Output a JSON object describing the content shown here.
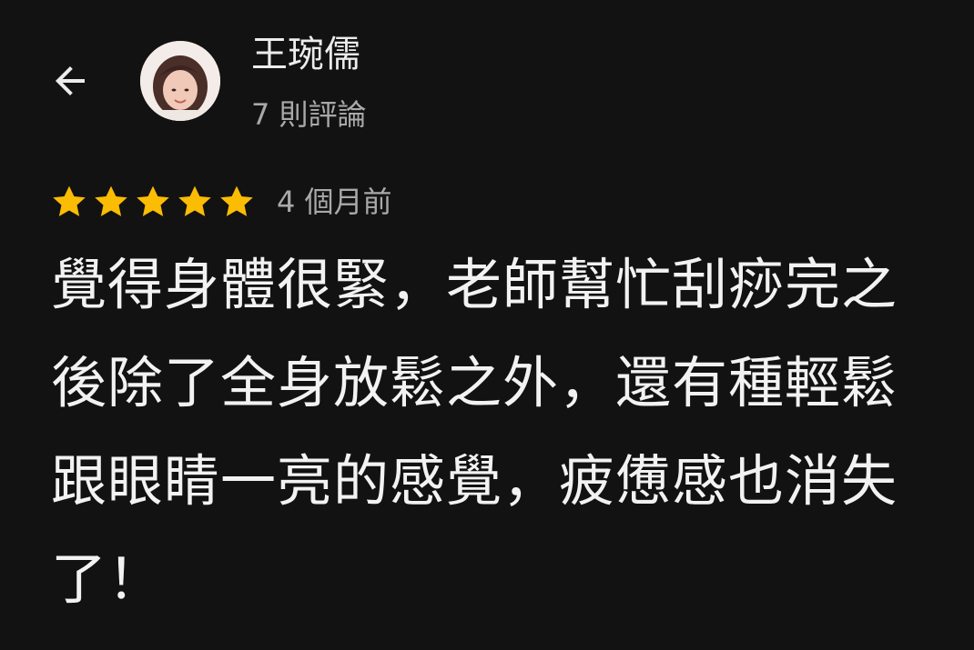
{
  "header": {
    "back_icon": "arrow-left-icon",
    "reviewer": {
      "name": "王琬儒",
      "review_count": "7 則評論",
      "avatar_icon": "user-avatar-photo"
    }
  },
  "review": {
    "rating": 5,
    "rating_max": 5,
    "star_icon": "star-icon",
    "star_color": "#fbbc04",
    "date": "4 個月前",
    "text": "覺得身體很緊，老師幫忙刮痧完之後除了全身放鬆之外，還有種輕鬆跟眼睛一亮的感覺，疲憊感也消失了！"
  },
  "colors": {
    "background": "#121212",
    "primary_text": "#f2f2f2",
    "secondary_text": "#a9a9a9"
  }
}
